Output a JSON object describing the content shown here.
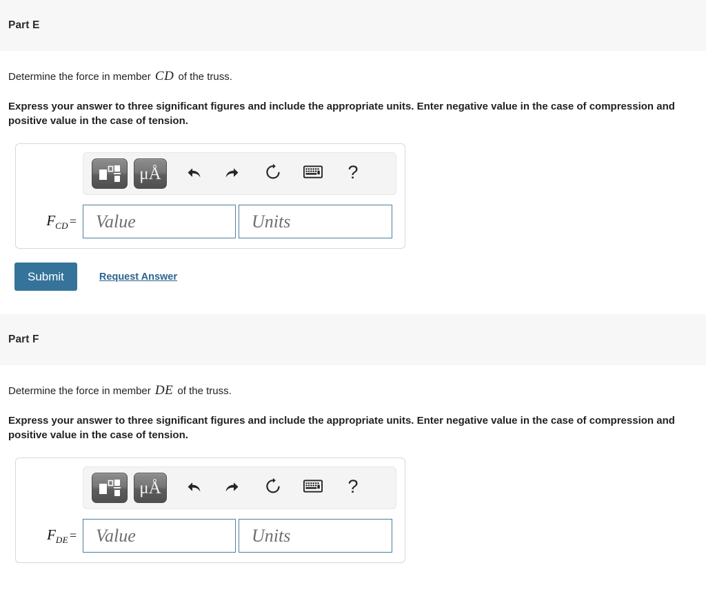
{
  "parts": [
    {
      "title": "Part E",
      "prompt_prefix": "Determine the force in member ",
      "prompt_member": "CD",
      "prompt_suffix": " of the truss.",
      "instruction": "Express your answer to three significant figures and include the appropriate units. Enter negative value in the case of compression and positive value in the case of tension.",
      "answer": {
        "label_symbol": "F",
        "label_sub": "CD",
        "label_equals": "=",
        "value_placeholder": "Value",
        "units_placeholder": "Units",
        "value_text": "",
        "units_text": ""
      },
      "toolbar": {
        "buttons": [
          {
            "name": "template-picker-button",
            "type": "icon",
            "icon": "math-template-icon",
            "label": ""
          },
          {
            "name": "units-picker-button",
            "type": "text",
            "icon": "micro-angstrom-icon",
            "label": "μÅ"
          },
          {
            "name": "undo-button",
            "type": "plain",
            "icon": "undo-arrow-icon",
            "label": ""
          },
          {
            "name": "redo-button",
            "type": "plain",
            "icon": "redo-arrow-icon",
            "label": ""
          },
          {
            "name": "reset-button",
            "type": "plain",
            "icon": "reset-circular-arrow-icon",
            "label": ""
          },
          {
            "name": "keyboard-button",
            "type": "plain",
            "icon": "keyboard-icon",
            "label": ""
          },
          {
            "name": "help-button",
            "type": "plain",
            "icon": "question-mark-icon",
            "label": "?"
          }
        ]
      },
      "actions": {
        "submit_label": "Submit",
        "request_answer_label": "Request Answer",
        "show_actions": true
      }
    },
    {
      "title": "Part F",
      "prompt_prefix": "Determine the force in member ",
      "prompt_member": "DE",
      "prompt_suffix": " of the truss.",
      "instruction": "Express your answer to three significant figures and include the appropriate units. Enter negative value in the case of compression and positive value in the case of tension.",
      "answer": {
        "label_symbol": "F",
        "label_sub": "DE",
        "label_equals": "=",
        "value_placeholder": "Value",
        "units_placeholder": "Units",
        "value_text": "",
        "units_text": ""
      },
      "toolbar": {
        "buttons": [
          {
            "name": "template-picker-button",
            "type": "icon",
            "icon": "math-template-icon",
            "label": ""
          },
          {
            "name": "units-picker-button",
            "type": "text",
            "icon": "micro-angstrom-icon",
            "label": "μÅ"
          },
          {
            "name": "undo-button",
            "type": "plain",
            "icon": "undo-arrow-icon",
            "label": ""
          },
          {
            "name": "redo-button",
            "type": "plain",
            "icon": "redo-arrow-icon",
            "label": ""
          },
          {
            "name": "reset-button",
            "type": "plain",
            "icon": "reset-circular-arrow-icon",
            "label": ""
          },
          {
            "name": "keyboard-button",
            "type": "plain",
            "icon": "keyboard-icon",
            "label": ""
          },
          {
            "name": "help-button",
            "type": "plain",
            "icon": "question-mark-icon",
            "label": "?"
          }
        ]
      },
      "actions": {
        "submit_label": "Submit",
        "request_answer_label": "Request Answer",
        "show_actions": false
      }
    }
  ],
  "colors": {
    "band_background": "#f7f7f7",
    "submit_button": "#35739b",
    "link": "#2b6490",
    "input_border": "#4c7d9c",
    "box_border": "#d8d8d8",
    "text": "#222222"
  }
}
